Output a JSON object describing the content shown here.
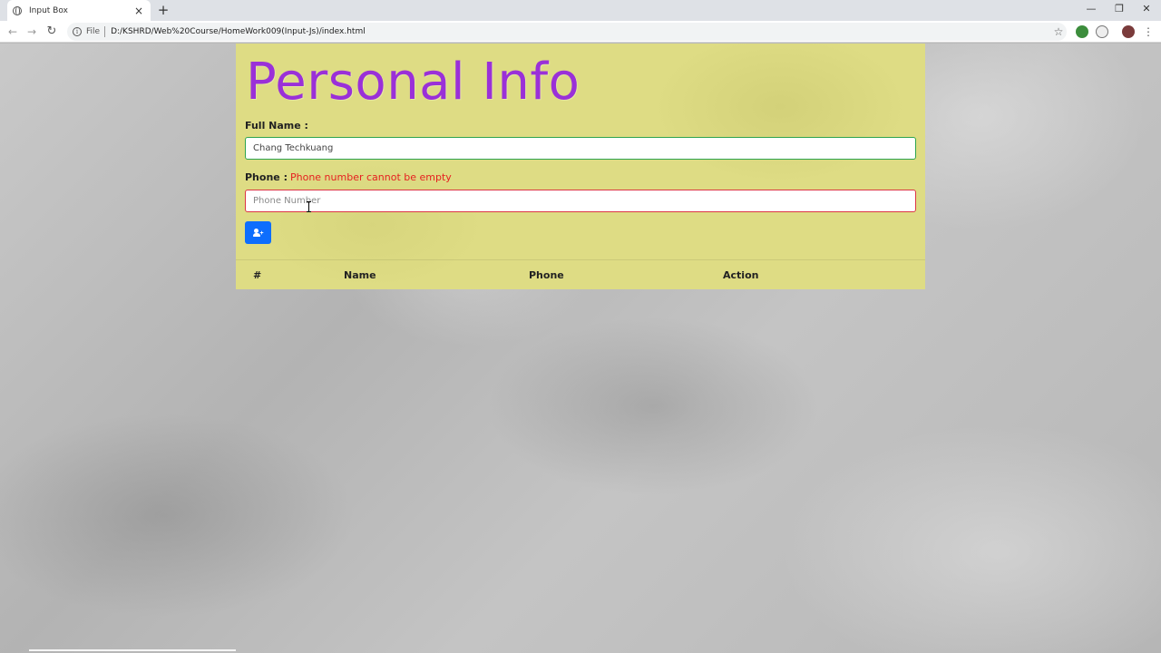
{
  "browser": {
    "tab_title": "Input Box",
    "tab_close": "×",
    "new_tab": "+",
    "scheme": "File",
    "url": "D:/KSHRD/Web%20Course/HomeWork009(Input-Js)/index.html",
    "window_controls": {
      "minimize": "—",
      "restore": "❐",
      "close": "✕"
    }
  },
  "page": {
    "title": "Personal Info",
    "full_name": {
      "label": "Full Name :",
      "value": "Chang Techkuang"
    },
    "phone": {
      "label": "Phone :",
      "error": "Phone number cannot be empty",
      "placeholder": "Phone Number",
      "value": ""
    },
    "add_button": {
      "icon": "user-plus-icon"
    },
    "table": {
      "headers": [
        "#",
        "Name",
        "Phone",
        "Action"
      ],
      "rows": []
    }
  },
  "colors": {
    "title": "#9a30d8",
    "card": "#dedc84",
    "valid_border": "#2ea44f",
    "invalid_border": "#dc3545",
    "error_text": "#e62020",
    "button": "#0d6efd"
  }
}
